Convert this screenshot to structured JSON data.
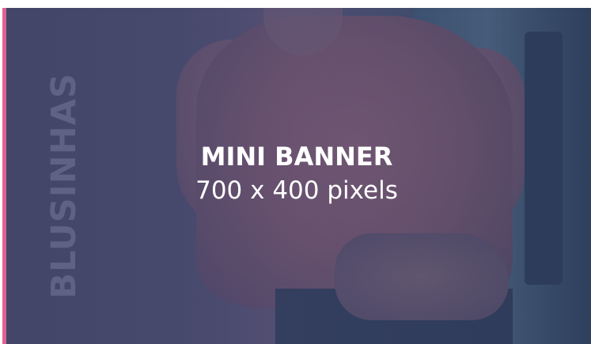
{
  "banner": {
    "side_label": "BLUSINHAS",
    "title": "MINI BANNER",
    "subtitle": "700 x 400 pixels",
    "colors": {
      "accent": "#e0628f",
      "overlay": "#3d4a66",
      "text": "#ffffff"
    }
  }
}
